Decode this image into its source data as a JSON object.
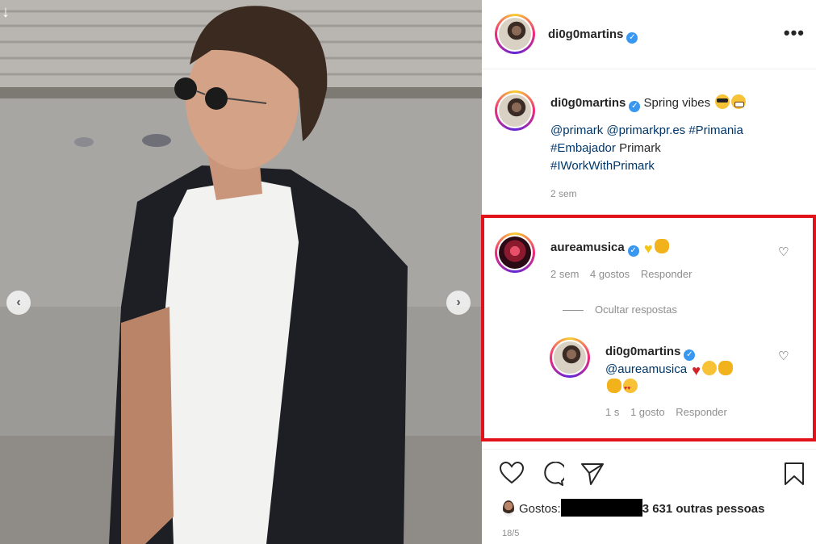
{
  "post": {
    "author": "di0g0martins",
    "more_icon": "•••",
    "caption_text": "Spring vibes",
    "caption_tags_line1": [
      "@primark",
      "@primarkpr.es",
      "#Primania"
    ],
    "caption_tags_line2_tag": "#Embajador",
    "caption_tags_line2_text": "Primark",
    "caption_tags_line3": "#IWorkWithPrimark",
    "caption_time": "2 sem"
  },
  "comment": {
    "author": "aureamusica",
    "time": "2 sem",
    "likes": "4 gostos",
    "reply_label": "Responder",
    "hide_replies": "Ocultar respostas"
  },
  "reply": {
    "author": "di0g0martins",
    "mention": "@aureamusica",
    "time": "1 s",
    "likes": "1 gosto",
    "reply_label": "Responder"
  },
  "footer": {
    "likes_prefix": "Gostos:",
    "likes_suffix": "3 631 outras pessoas",
    "date": "18/5"
  },
  "icons": [
    "download-arrow-icon",
    "chevron-left-icon",
    "chevron-right-icon",
    "verified-badge-icon",
    "heart-icon",
    "comment-icon",
    "share-icon",
    "bookmark-icon"
  ],
  "colors": {
    "highlight": "#e2121a",
    "link": "#00376b",
    "meta": "#8e8e8e",
    "verified": "#3897f0"
  }
}
